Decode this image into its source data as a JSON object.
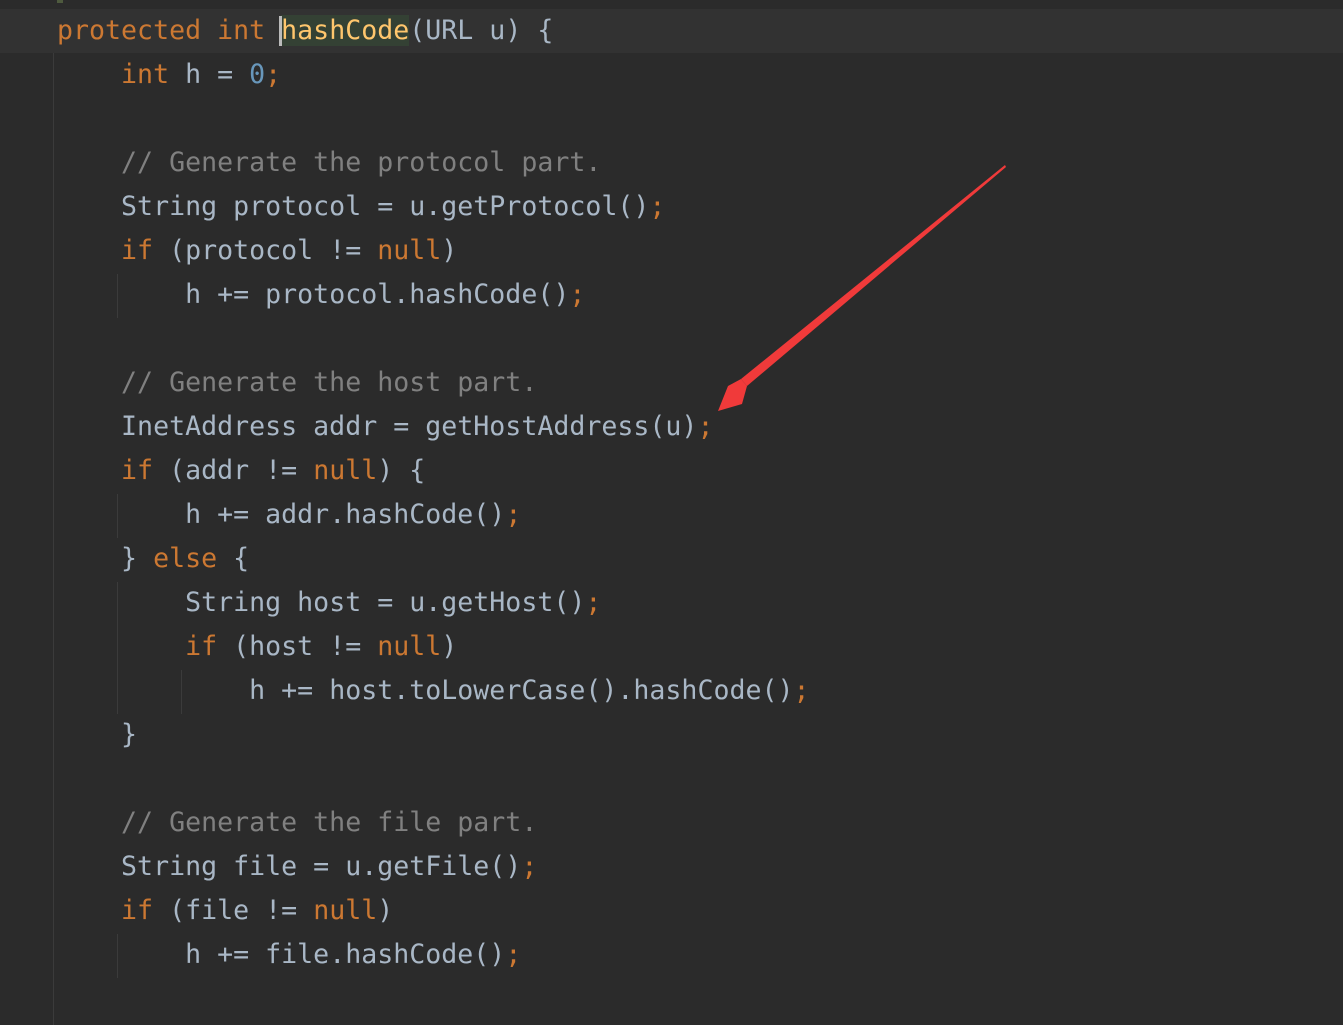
{
  "editor": {
    "theme_colors": {
      "background": "#2b2b2b",
      "current_line": "#323232",
      "keyword": "#cc7832",
      "number": "#6897bb",
      "comment": "#808080",
      "method_declaration": "#ffc66d",
      "identifier": "#a9b7c6",
      "annotation_arrow": "#f03a3a"
    },
    "lines": [
      {
        "tokens": [
          {
            "t": "protected ",
            "c": "kw"
          },
          {
            "t": "int ",
            "c": "kw"
          },
          {
            "t": "hashCode",
            "c": "fn-decl highlight"
          },
          {
            "t": "(URL u) {",
            "c": "plain"
          }
        ]
      },
      {
        "tokens": [
          {
            "t": "    "
          },
          {
            "t": "int ",
            "c": "kw"
          },
          {
            "t": "h = ",
            "c": "plain"
          },
          {
            "t": "0",
            "c": "num"
          },
          {
            "t": ";",
            "c": "semi"
          }
        ]
      },
      {
        "tokens": []
      },
      {
        "tokens": [
          {
            "t": "    "
          },
          {
            "t": "// Generate the protocol part.",
            "c": "cmt"
          }
        ]
      },
      {
        "tokens": [
          {
            "t": "    "
          },
          {
            "t": "String protocol = u.getProtocol()",
            "c": "plain"
          },
          {
            "t": ";",
            "c": "semi"
          }
        ]
      },
      {
        "tokens": [
          {
            "t": "    "
          },
          {
            "t": "if ",
            "c": "kw"
          },
          {
            "t": "(protocol != ",
            "c": "plain"
          },
          {
            "t": "null",
            "c": "kw"
          },
          {
            "t": ")",
            "c": "plain"
          }
        ]
      },
      {
        "tokens": [
          {
            "t": "        "
          },
          {
            "t": "h += protocol.hashCode()",
            "c": "plain"
          },
          {
            "t": ";",
            "c": "semi"
          }
        ]
      },
      {
        "tokens": []
      },
      {
        "tokens": [
          {
            "t": "    "
          },
          {
            "t": "// Generate the host part.",
            "c": "cmt"
          }
        ]
      },
      {
        "tokens": [
          {
            "t": "    "
          },
          {
            "t": "InetAddress addr = getHostAddress(u)",
            "c": "plain"
          },
          {
            "t": ";",
            "c": "semi"
          }
        ]
      },
      {
        "tokens": [
          {
            "t": "    "
          },
          {
            "t": "if ",
            "c": "kw"
          },
          {
            "t": "(addr != ",
            "c": "plain"
          },
          {
            "t": "null",
            "c": "kw"
          },
          {
            "t": ") {",
            "c": "plain"
          }
        ]
      },
      {
        "tokens": [
          {
            "t": "        "
          },
          {
            "t": "h += addr.hashCode()",
            "c": "plain"
          },
          {
            "t": ";",
            "c": "semi"
          }
        ]
      },
      {
        "tokens": [
          {
            "t": "    "
          },
          {
            "t": "} ",
            "c": "plain"
          },
          {
            "t": "else ",
            "c": "kw"
          },
          {
            "t": "{",
            "c": "plain"
          }
        ]
      },
      {
        "tokens": [
          {
            "t": "        "
          },
          {
            "t": "String host = u.getHost()",
            "c": "plain"
          },
          {
            "t": ";",
            "c": "semi"
          }
        ]
      },
      {
        "tokens": [
          {
            "t": "        "
          },
          {
            "t": "if ",
            "c": "kw"
          },
          {
            "t": "(host != ",
            "c": "plain"
          },
          {
            "t": "null",
            "c": "kw"
          },
          {
            "t": ")",
            "c": "plain"
          }
        ]
      },
      {
        "tokens": [
          {
            "t": "            "
          },
          {
            "t": "h += host.toLowerCase().hashCode()",
            "c": "plain"
          },
          {
            "t": ";",
            "c": "semi"
          }
        ]
      },
      {
        "tokens": [
          {
            "t": "    "
          },
          {
            "t": "}",
            "c": "plain"
          }
        ]
      },
      {
        "tokens": []
      },
      {
        "tokens": [
          {
            "t": "    "
          },
          {
            "t": "// Generate the file part.",
            "c": "cmt"
          }
        ]
      },
      {
        "tokens": [
          {
            "t": "    "
          },
          {
            "t": "String file = u.getFile()",
            "c": "plain"
          },
          {
            "t": ";",
            "c": "semi"
          }
        ]
      },
      {
        "tokens": [
          {
            "t": "    "
          },
          {
            "t": "if ",
            "c": "kw"
          },
          {
            "t": "(file != ",
            "c": "plain"
          },
          {
            "t": "null",
            "c": "kw"
          },
          {
            "t": ")",
            "c": "plain"
          }
        ]
      },
      {
        "tokens": [
          {
            "t": "        "
          },
          {
            "t": "h += file.hashCode()",
            "c": "plain"
          },
          {
            "t": ";",
            "c": "semi"
          }
        ]
      }
    ],
    "annotation": {
      "type": "arrow",
      "points_to": "getHostAddress(u);",
      "color": "#f03a3a"
    }
  }
}
